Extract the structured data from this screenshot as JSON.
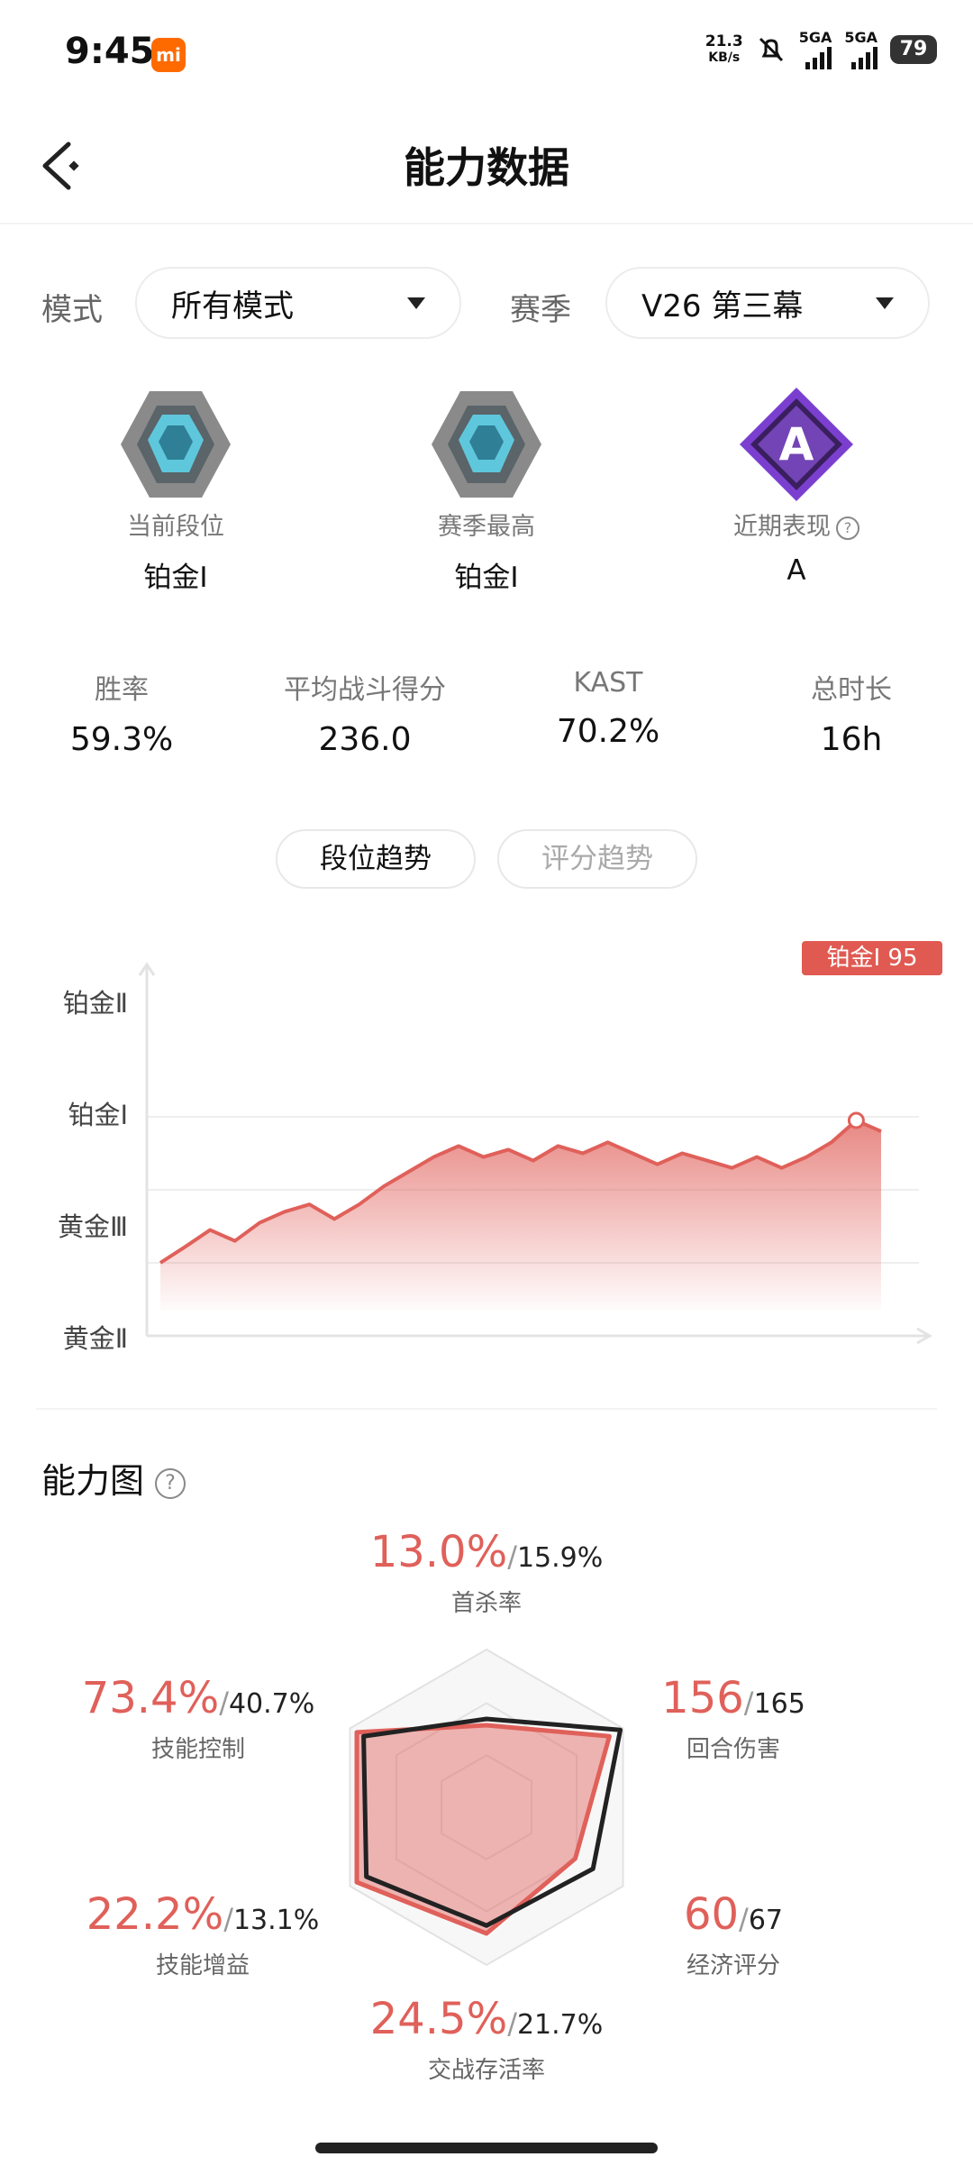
{
  "status_bar": {
    "time": "9:45",
    "mi_badge": "mi",
    "net_speed_top": "21.3",
    "net_speed_bottom": "KB/s",
    "sim1": "5GA",
    "sim2": "5GA",
    "battery": "79"
  },
  "header": {
    "title": "能力数据",
    "back_icon": "back-arrow-icon"
  },
  "filters": {
    "mode_label": "模式",
    "mode_value": "所有模式",
    "season_label": "赛季",
    "season_value": "V26 第三幕"
  },
  "ranks": [
    {
      "label": "当前段位",
      "value": "铂金Ⅰ",
      "icon": "platinum-rank-icon"
    },
    {
      "label": "赛季最高",
      "value": "铂金Ⅰ",
      "icon": "platinum-rank-icon"
    },
    {
      "label": "近期表现",
      "value": "A",
      "icon": "grade-a-icon"
    }
  ],
  "stats": [
    {
      "label": "胜率",
      "value": "59.3%"
    },
    {
      "label": "平均战斗得分",
      "value": "236.0"
    },
    {
      "label": "KAST",
      "value": "70.2%"
    },
    {
      "label": "总时长",
      "value": "16h"
    }
  ],
  "tabs": {
    "active": "段位趋势",
    "inactive": "评分趋势"
  },
  "colors": {
    "accent": "#e0605a",
    "tag_bg": "#e05a52",
    "player_line": "#222222"
  },
  "chart_data": {
    "type": "area",
    "y_categories": [
      "黄金Ⅱ",
      "黄金Ⅲ",
      "铂金Ⅰ",
      "铂金Ⅱ"
    ],
    "y_tick_labels": [
      "铂金Ⅱ",
      "铂金Ⅰ",
      "黄金Ⅲ",
      "黄金Ⅱ"
    ],
    "values": [
      1.0,
      1.22,
      1.45,
      1.3,
      1.55,
      1.7,
      1.8,
      1.6,
      1.8,
      2.05,
      2.25,
      2.45,
      2.6,
      2.45,
      2.55,
      2.4,
      2.6,
      2.5,
      2.65,
      2.5,
      2.35,
      2.5,
      2.4,
      2.3,
      2.45,
      2.3,
      2.45,
      2.65,
      2.95,
      2.8
    ],
    "last_point_label": "铂金Ⅰ 95",
    "grid": true
  },
  "ability": {
    "title": "能力图",
    "metrics": [
      {
        "name": "首杀率",
        "value": "13.0%",
        "compare": "15.9%"
      },
      {
        "name": "回合伤害",
        "value": "156",
        "compare": "165"
      },
      {
        "name": "经济评分",
        "value": "60",
        "compare": "67"
      },
      {
        "name": "交战存活率",
        "value": "24.5%",
        "compare": "21.7%"
      },
      {
        "name": "技能增益",
        "value": "22.2%",
        "compare": "13.1%"
      },
      {
        "name": "技能控制",
        "value": "73.4%",
        "compare": "40.7%"
      }
    ],
    "radar_player": [
      0.52,
      0.9,
      0.65,
      0.8,
      0.95,
      0.95
    ],
    "radar_compare": [
      0.56,
      0.98,
      0.78,
      0.75,
      0.88,
      0.9
    ]
  }
}
